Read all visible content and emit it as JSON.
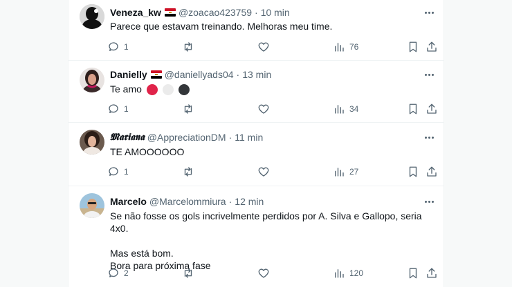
{
  "tweets": [
    {
      "name": "Veneza_kw",
      "has_flag": true,
      "handle": "@zoacao423759",
      "time": "10 min",
      "text": "Parece que estavam treinando. Melhoras meu time.",
      "replies": "1",
      "retweets": "",
      "likes": "",
      "views": "76"
    },
    {
      "name": "Danielly",
      "has_flag": true,
      "handle": "@daniellyads04",
      "time": "13 min",
      "text": "Te amo",
      "emoji_circles": [
        "#e0244a",
        "#ebebeb",
        "#333639"
      ],
      "replies": "1",
      "retweets": "",
      "likes": "",
      "views": "34"
    },
    {
      "name": "𝕸𝖆𝖗𝖎𝖆𝖓𝖆",
      "has_flag": false,
      "handle": "@AppreciationDM",
      "time": "11 min",
      "text": "TE AMOOOOOO",
      "replies": "1",
      "retweets": "",
      "likes": "",
      "views": "27"
    },
    {
      "name": "Marcelo",
      "has_flag": false,
      "handle": "@Marcelommiura",
      "time": "12 min",
      "text_lines": [
        "Se não fosse os gols incrivelmente perdidos por A. Silva e Gallopo, seria 4x0.",
        "",
        "Mas está bom.",
        "Bora para próxima fase"
      ],
      "replies": "2",
      "retweets": "",
      "likes": "",
      "views": "120"
    }
  ],
  "separator": "·",
  "icons": {
    "reply": "reply-icon",
    "retweet": "retweet-icon",
    "like": "like-icon",
    "views": "views-icon",
    "bookmark": "bookmark-icon",
    "share": "share-icon",
    "more": "more-icon"
  },
  "colors": {
    "text": "#0f1419",
    "secondary": "#536471",
    "border": "#eff3f4",
    "flag_red": "#ce1126",
    "flag_black": "#000000"
  }
}
